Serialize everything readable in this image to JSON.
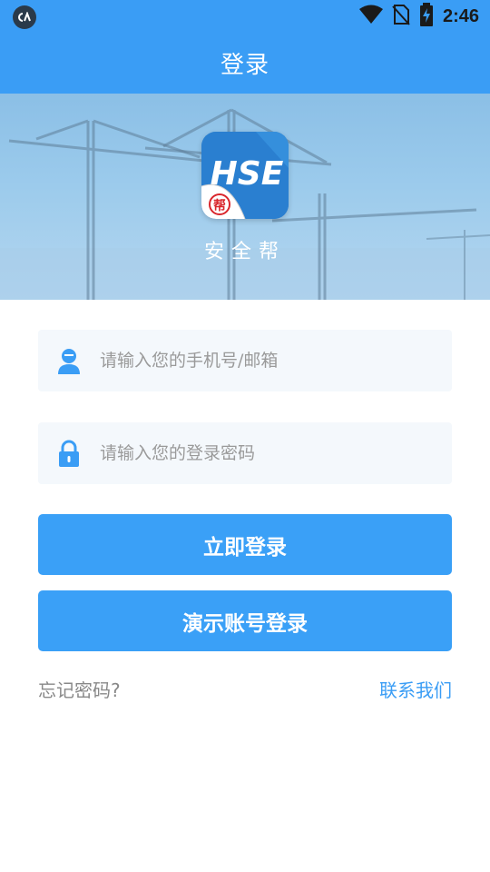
{
  "status_bar": {
    "time": "2:46",
    "icons": [
      "app-notification-icon",
      "wifi-icon",
      "no-sim-icon",
      "battery-charging-icon"
    ]
  },
  "header": {
    "title": "登录"
  },
  "banner": {
    "logo_text": "HSE",
    "logo_badge": "帮",
    "app_name": "安全帮"
  },
  "form": {
    "username": {
      "placeholder": "请输入您的手机号/邮箱",
      "value": "",
      "icon": "user-icon"
    },
    "password": {
      "placeholder": "请输入您的登录密码",
      "value": "",
      "icon": "lock-icon"
    },
    "login_button": "立即登录",
    "demo_button": "演示账号登录",
    "forgot_link": "忘记密码?",
    "contact_link": "联系我们"
  },
  "colors": {
    "primary": "#3a9df5",
    "button": "#3aa0f7",
    "field_bg": "#f4f8fc",
    "muted_text": "#888888"
  }
}
